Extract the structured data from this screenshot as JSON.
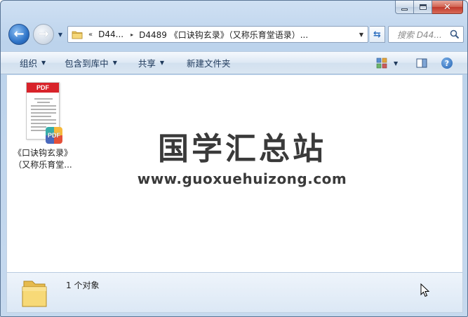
{
  "window": {
    "caption": {
      "minimize": "minimize",
      "maximize": "maximize",
      "close": "✕"
    }
  },
  "nav": {
    "back_glyph": "←",
    "forward_glyph": "→",
    "history_caret": "▼"
  },
  "address": {
    "overflow_chevron": "«",
    "crumbs": [
      "D44...",
      "D4489 《口诀钩玄录》（又称乐育堂语录）..."
    ],
    "separator": "▸",
    "dropdown_caret": "▼"
  },
  "refresh_glyph": "⇆",
  "search": {
    "placeholder": "搜索 D44..."
  },
  "toolbar": {
    "organize": "组织",
    "include_in_library": "包含到库中",
    "share": "共享",
    "new_folder": "新建文件夹",
    "caret": "▼",
    "help": "?"
  },
  "files": [
    {
      "type_badge": "PDF",
      "name_line1": "《口诀钩玄录》",
      "name_line2": "（又称乐育堂..."
    }
  ],
  "watermark": {
    "title": "国学汇总站",
    "url": "www.guoxuehuizong.com"
  },
  "details": {
    "count_text": "1 个对象"
  }
}
